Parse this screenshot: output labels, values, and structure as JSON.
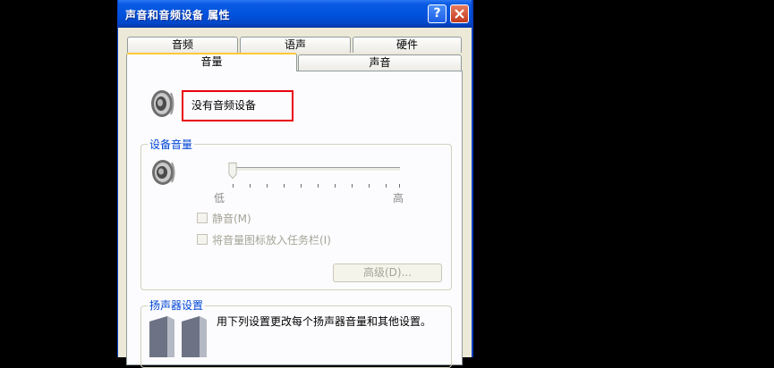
{
  "window": {
    "title": "声音和音频设备 属性",
    "help_label": "?"
  },
  "tabs_row1": [
    "音频",
    "语声",
    "硬件"
  ],
  "tabs_row2": [
    "音量",
    "声音"
  ],
  "active_tab": "音量",
  "device": {
    "name": "没有音频设备",
    "icon": "speaker-icon"
  },
  "device_volume": {
    "group_title": "设备音量",
    "low_label": "低",
    "high_label": "高",
    "level": 0,
    "mute_label": "静音(M)",
    "mute_checked": false,
    "tray_label": "将音量图标放入任务栏(I)",
    "tray_checked": false,
    "advanced_label": "高级(D)...",
    "enabled": false
  },
  "speaker_settings": {
    "group_title": "扬声器设置",
    "description": "用下列设置更改每个扬声器音量和其他设置。"
  },
  "colors": {
    "titlebar": "#0051dc",
    "highlight_box": "#e8000b",
    "group_title": "#0046d5",
    "disabled_text": "#a5a497"
  }
}
